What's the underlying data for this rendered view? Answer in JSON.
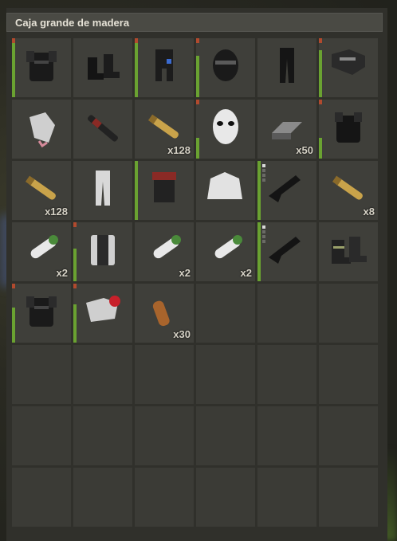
{
  "container": {
    "title": "Caja grande de madera"
  },
  "colors": {
    "condition_good": "#6aa231",
    "condition_damaged": "#b14a2e",
    "slot_bg": "#3f3f3a"
  },
  "slots": [
    {
      "icon": "metal-chest-plate-icon",
      "qty": "",
      "condition": 0.95
    },
    {
      "icon": "boots-icon",
      "qty": "",
      "condition": null
    },
    {
      "icon": "roadsign-kilt-icon",
      "qty": "",
      "condition": 0.95
    },
    {
      "icon": "metal-facemask-icon",
      "qty": "",
      "condition": 0.7
    },
    {
      "icon": "pants-icon",
      "qty": "",
      "condition": null
    },
    {
      "icon": "roadsign-jacket-icon",
      "qty": "",
      "condition": 0.8
    },
    {
      "icon": "gloves-icon",
      "qty": "",
      "condition": null
    },
    {
      "icon": "flashlight-icon",
      "qty": "",
      "condition": null
    },
    {
      "icon": "rifle-ammo-icon",
      "qty": "x128",
      "condition": null
    },
    {
      "icon": "hockey-mask-icon",
      "qty": "",
      "condition": 0.35
    },
    {
      "icon": "metal-ingot-icon",
      "qty": "x50",
      "condition": null
    },
    {
      "icon": "chest-plate-icon",
      "qty": "",
      "condition": 0.35
    },
    {
      "icon": "rifle-ammo-icon",
      "qty": "x128",
      "condition": null
    },
    {
      "icon": "hazmat-pants-icon",
      "qty": "",
      "condition": null
    },
    {
      "icon": "bucket-helmet-icon",
      "qty": "",
      "condition": 1.0
    },
    {
      "icon": "hoodie-icon",
      "qty": "",
      "condition": null
    },
    {
      "icon": "assault-rifle-icon",
      "qty": "",
      "condition": 1.0
    },
    {
      "icon": "rifle-ammo-icon",
      "qty": "x8",
      "condition": null
    },
    {
      "icon": "rocket-icon",
      "qty": "x2",
      "condition": null
    },
    {
      "icon": "metal-vest-icon",
      "qty": "",
      "condition": 0.55
    },
    {
      "icon": "rocket-icon",
      "qty": "x2",
      "condition": null
    },
    {
      "icon": "rocket-icon",
      "qty": "x2",
      "condition": null
    },
    {
      "icon": "assault-rifle-icon",
      "qty": "",
      "condition": 1.0
    },
    {
      "icon": "heavy-boots-icon",
      "qty": "",
      "condition": null
    },
    {
      "icon": "metal-chest-plate-icon",
      "qty": "",
      "condition": 0.6
    },
    {
      "icon": "salvaged-tool-icon",
      "qty": "",
      "condition": 0.65
    },
    {
      "icon": "pistol-ammo-icon",
      "qty": "x30",
      "condition": null
    },
    {
      "icon": "",
      "qty": "",
      "condition": null
    },
    {
      "icon": "",
      "qty": "",
      "condition": null
    },
    {
      "icon": "",
      "qty": "",
      "condition": null
    }
  ],
  "empty_rows": 3
}
